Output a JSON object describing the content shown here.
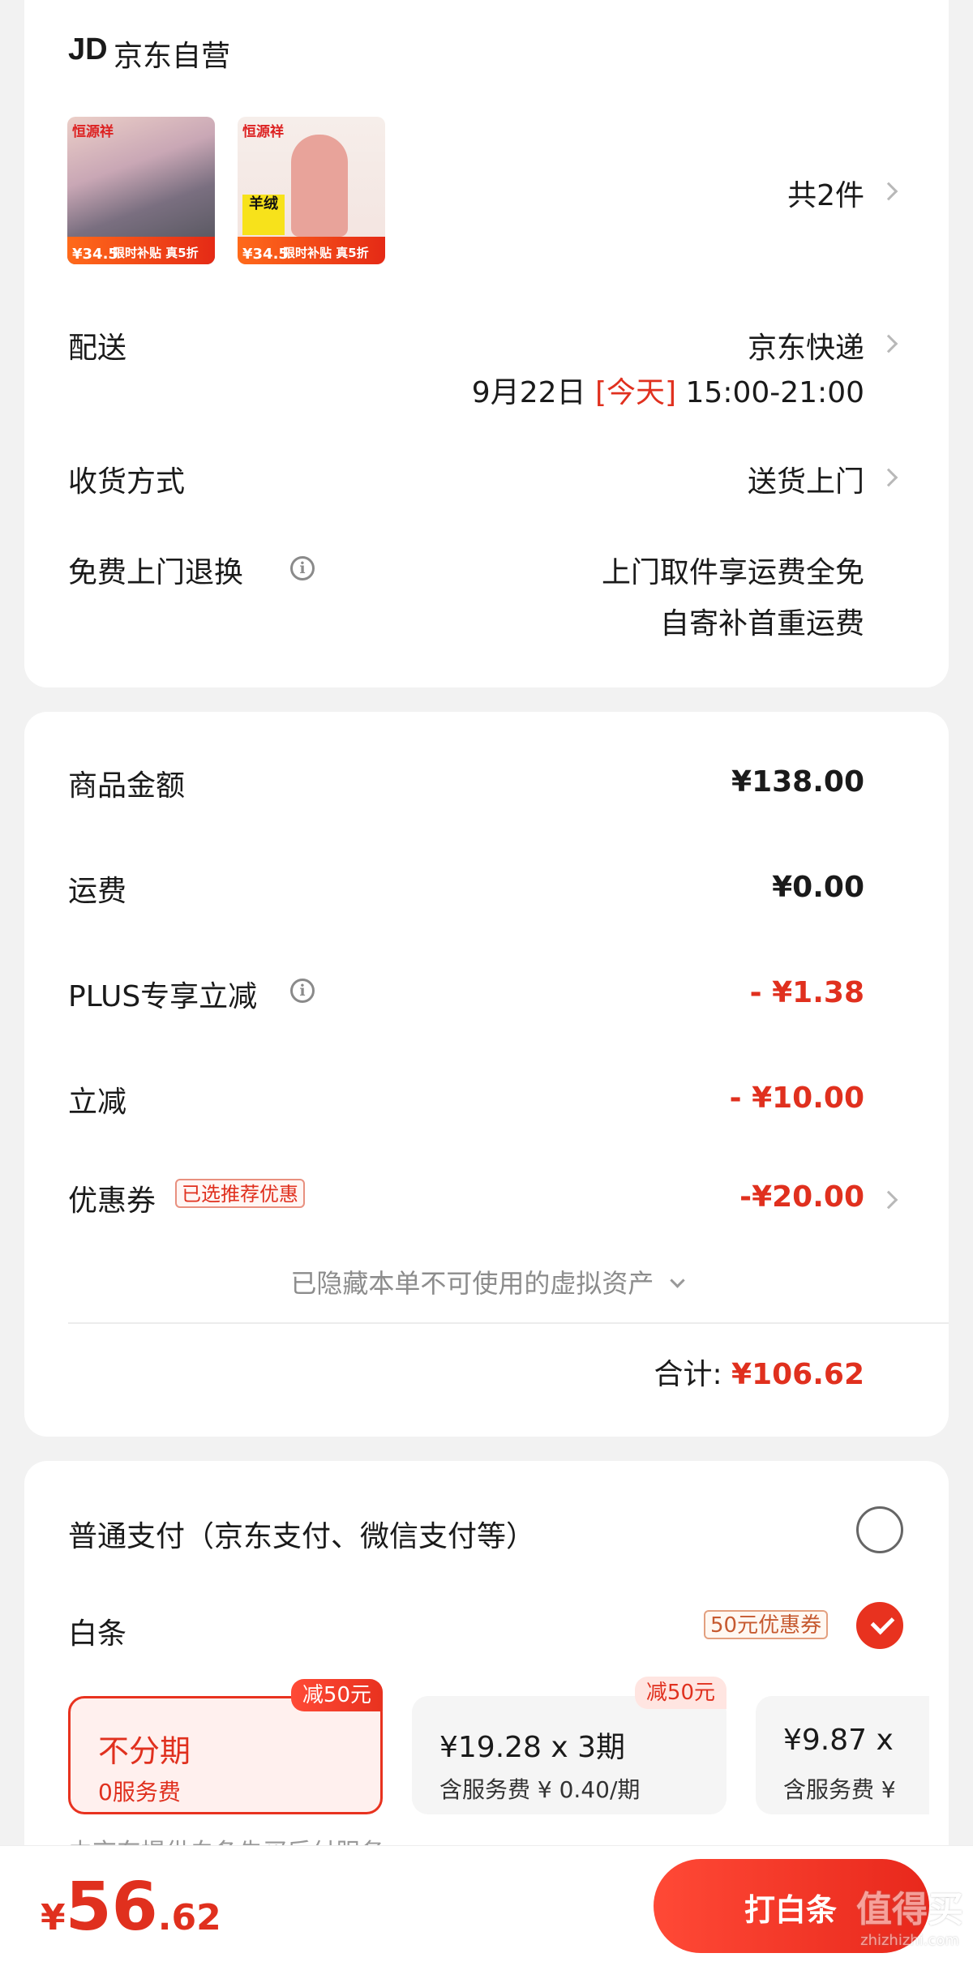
{
  "store": {
    "logo": "JD",
    "name": "京东自营"
  },
  "products": {
    "count_label": "共2件",
    "thumbs": [
      {
        "brand": "恒源祥",
        "price": "¥34.5",
        "promo": "限时补贴 真5折",
        "badge": "羊绒"
      },
      {
        "brand": "恒源祥",
        "price": "¥34.5",
        "promo": "限时补贴 真5折",
        "badge": "羊绒"
      }
    ]
  },
  "delivery": {
    "label": "配送",
    "carrier": "京东快递",
    "date": "9月22日",
    "today": "[今天]",
    "time": "15:00-21:00"
  },
  "receive": {
    "label": "收货方式",
    "value": "送货上门"
  },
  "free_return": {
    "label": "免费上门退换",
    "line1": "上门取件享运费全免",
    "line2": "自寄补首重运费"
  },
  "amounts": {
    "goods_label": "商品金额",
    "goods_value": "¥138.00",
    "shipping_label": "运费",
    "shipping_value": "¥0.00",
    "plus_label": "PLUS专享立减",
    "plus_value": "- ¥1.38",
    "discount_label": "立减",
    "discount_value": "- ¥10.00",
    "coupon_label": "优惠券",
    "coupon_tag": "已选推荐优惠",
    "coupon_value": "-¥20.00",
    "hidden_assets": "已隐藏本单不可使用的虚拟资产",
    "total_label": "合计:",
    "total_value": "¥106.62"
  },
  "payment": {
    "normal_label": "普通支付（京东支付、微信支付等）",
    "baitiao_label": "白条",
    "baitiao_coupon": "50元优惠券",
    "plans": [
      {
        "badge": "减50元",
        "title": "不分期",
        "sub": "0服务费"
      },
      {
        "badge": "减50元",
        "title": "¥19.28 x 3期",
        "sub": "含服务费 ¥ 0.40/期"
      },
      {
        "title": "¥9.87 x",
        "sub": "含服务费 ¥"
      }
    ],
    "footnote": "由京东提供白条先买后付服务"
  },
  "bottom_bar": {
    "currency": "¥",
    "price_int": "56",
    "price_dec": ".62",
    "pay_button": "打白条"
  },
  "watermark": {
    "text": "值得买",
    "domain": "zhizhizhi.com"
  },
  "colors": {
    "accent": "#e8321f",
    "price_red": "#e0301e",
    "background": "#f2f2f2"
  }
}
